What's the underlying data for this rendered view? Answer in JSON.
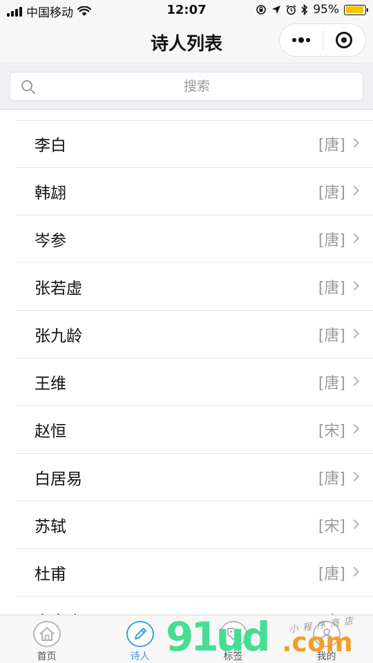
{
  "status_bar": {
    "carrier": "中国移动",
    "time": "12:07",
    "battery_percent": "95%",
    "battery_level": 0.95,
    "battery_color": "#f5c400"
  },
  "nav_bar": {
    "title": "诗人列表"
  },
  "search": {
    "placeholder": "搜索"
  },
  "poets": [
    {
      "name": "李白",
      "dynasty": "[唐]"
    },
    {
      "name": "韩翃",
      "dynasty": "[唐]"
    },
    {
      "name": "岑参",
      "dynasty": "[唐]"
    },
    {
      "name": "张若虚",
      "dynasty": "[唐]"
    },
    {
      "name": "张九龄",
      "dynasty": "[唐]"
    },
    {
      "name": "王维",
      "dynasty": "[唐]"
    },
    {
      "name": "赵恒",
      "dynasty": "[宋]"
    },
    {
      "name": "白居易",
      "dynasty": "[唐]"
    },
    {
      "name": "苏轼",
      "dynasty": "[宋]"
    },
    {
      "name": "杜甫",
      "dynasty": "[唐]"
    },
    {
      "name": "李商隐",
      "dynasty": "[唐]"
    }
  ],
  "tab_bar": {
    "accent_color": "#3a9fe0",
    "tabs": [
      {
        "label": "首页",
        "icon": "home-icon",
        "active": false
      },
      {
        "label": "诗人",
        "icon": "pen-icon",
        "active": true
      },
      {
        "label": "标签",
        "icon": "tag-icon",
        "active": false
      },
      {
        "label": "我的",
        "icon": "user-icon",
        "active": false
      }
    ]
  },
  "watermark": {
    "brand": "91ud",
    "domain": ".com",
    "tagline": "小程序商店"
  }
}
